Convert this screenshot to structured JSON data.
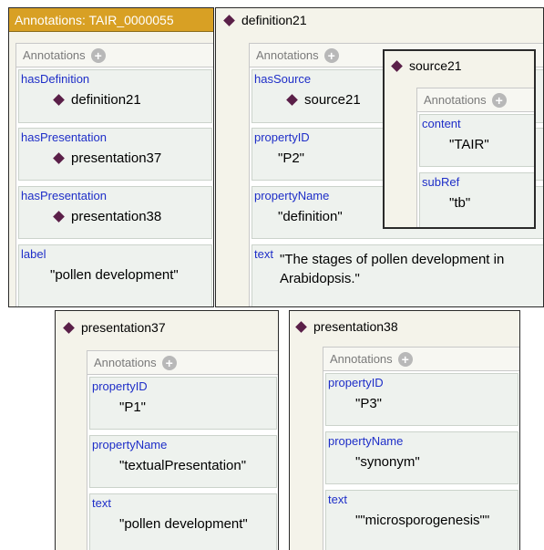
{
  "p1": {
    "title": "Annotations: TAIR_0000055",
    "header": "Annotations",
    "rows": [
      {
        "property": "hasDefinition",
        "value": "definition21"
      },
      {
        "property": "hasPresentation",
        "value": "presentation37"
      },
      {
        "property": "hasPresentation",
        "value": "presentation38"
      },
      {
        "property": "label",
        "value": "\"pollen development\""
      }
    ]
  },
  "p2": {
    "title": "definition21",
    "header": "Annotations",
    "rows": [
      {
        "property": "hasSource",
        "value": "source21"
      },
      {
        "property": "propertyID",
        "value": "\"P2\""
      },
      {
        "property": "propertyName",
        "value": "\"definition\""
      },
      {
        "property": "text",
        "value_line1": "\"The stages of pollen development in",
        "value_line2": "Arabidopsis.\""
      }
    ]
  },
  "p3": {
    "title": "source21",
    "header": "Annotations",
    "rows": [
      {
        "property": "content",
        "value": "\"TAIR\""
      },
      {
        "property": "subRef",
        "value": "\"tb\""
      }
    ]
  },
  "p4": {
    "title": "presentation37",
    "header": "Annotations",
    "rows": [
      {
        "property": "propertyID",
        "value": "\"P1\""
      },
      {
        "property": "propertyName",
        "value": "\"textualPresentation\""
      },
      {
        "property": "text",
        "value": "\"pollen development\""
      }
    ]
  },
  "p5": {
    "title": "presentation38",
    "header": "Annotations",
    "rows": [
      {
        "property": "propertyID",
        "value": "\"P3\""
      },
      {
        "property": "propertyName",
        "value": "\"synonym\""
      },
      {
        "property": "text",
        "value": "\"\"microsporogenesis\"\""
      }
    ]
  },
  "colors": {
    "title_bar": "#d8a024",
    "property_text": "#1e2ec8",
    "diamond": "#5a1f48",
    "panel_bg": "#f4f3ea",
    "row_bg": "#eef2ee"
  },
  "icons": {
    "individual": "diamond-icon",
    "add": "plus-circle-icon"
  }
}
